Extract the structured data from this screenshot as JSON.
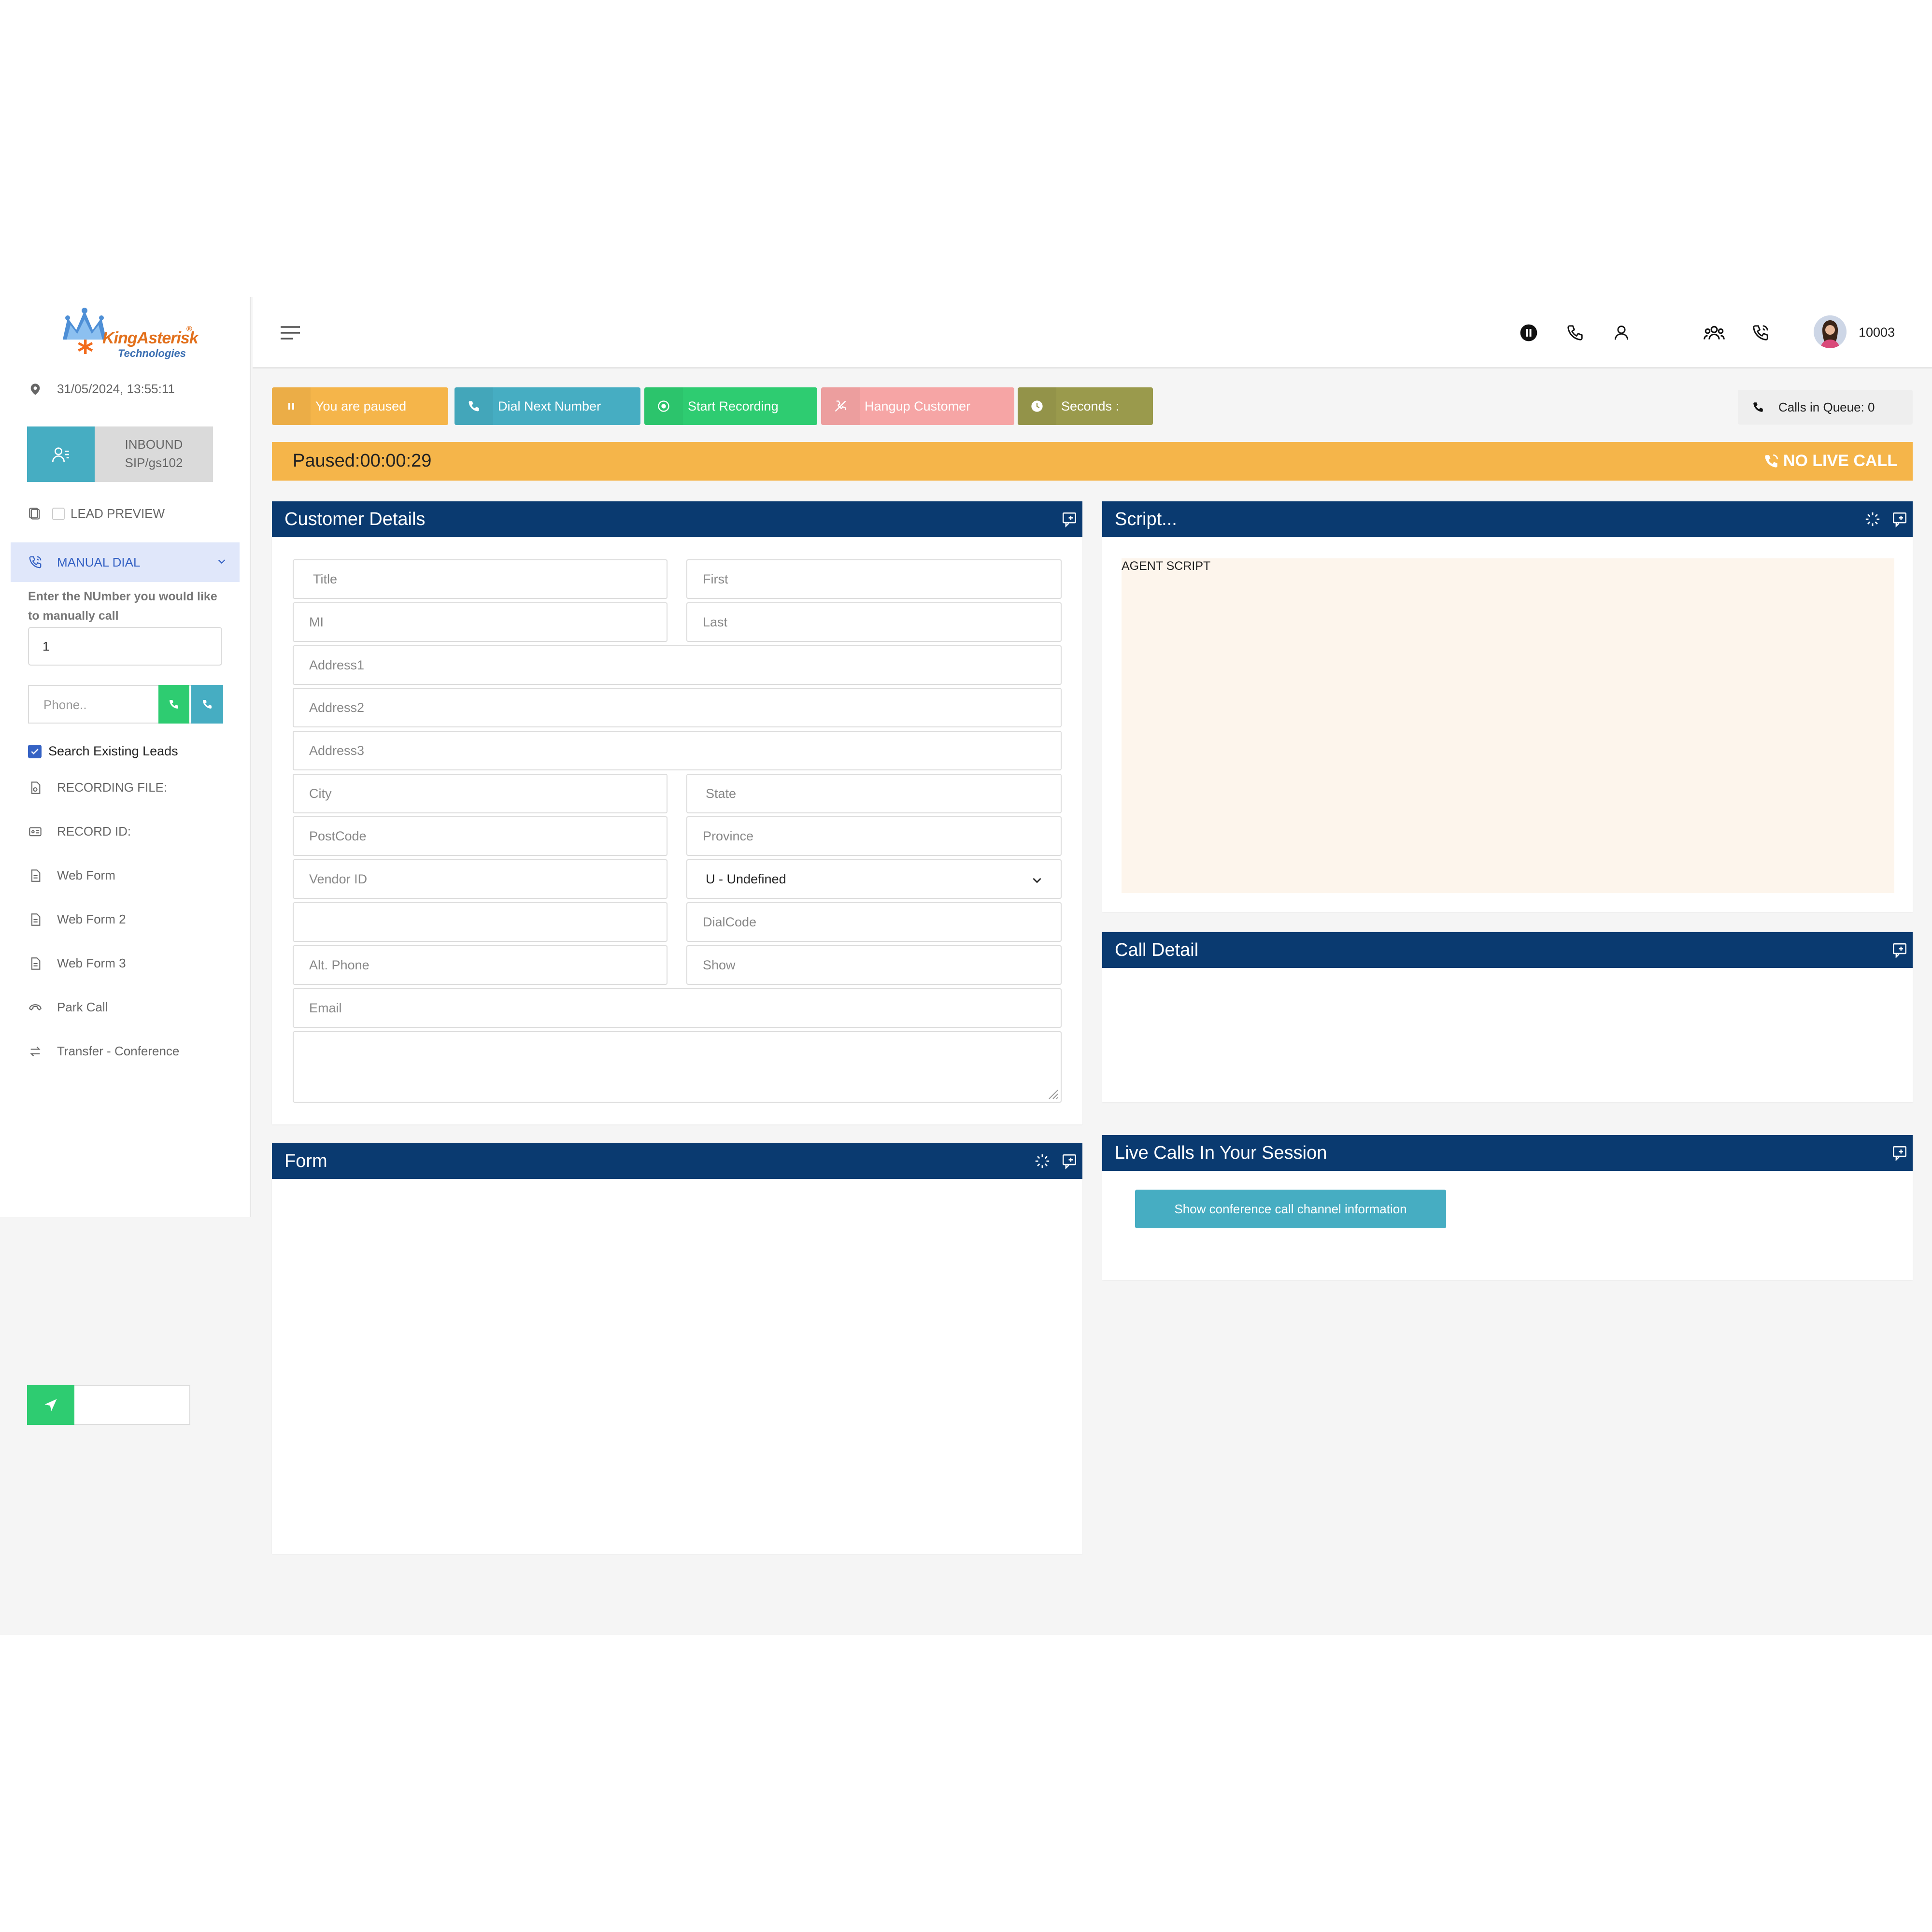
{
  "brand": {
    "name": "KingAsterisk",
    "tagline": "Technologies",
    "trademark": "®"
  },
  "sidebar": {
    "datetime": "31/05/2024, 13:55:11",
    "inbound": {
      "line1": "INBOUND",
      "line2": "SIP/gs102"
    },
    "lead_preview": "LEAD PREVIEW",
    "manual_dial": "MANUAL DIAL",
    "manual_label": "Enter the NUmber you would like to manually call",
    "manual_value": "1",
    "phone_placeholder": "Phone..",
    "search_existing": "Search Existing Leads",
    "items": [
      {
        "label": "RECORDING FILE:",
        "icon": "recording-file-icon"
      },
      {
        "label": "RECORD ID:",
        "icon": "id-card-icon"
      },
      {
        "label": "Web Form",
        "icon": "document-icon"
      },
      {
        "label": "Web Form 2",
        "icon": "document-icon"
      },
      {
        "label": "Web Form 3",
        "icon": "document-icon"
      },
      {
        "label": "Park Call",
        "icon": "park-call-icon"
      },
      {
        "label": "Transfer - Conference",
        "icon": "transfer-icon"
      }
    ]
  },
  "header": {
    "user_id": "10003"
  },
  "actions": {
    "paused": "You are paused",
    "dial_next": "Dial Next Number",
    "start_recording": "Start Recording",
    "hangup": "Hangup Customer",
    "seconds": "Seconds :",
    "calls_in_queue": "Calls in Queue: 0"
  },
  "status": {
    "paused_time": "Paused:00:00:29",
    "no_live_call": "NO LIVE CALL"
  },
  "customer_details": {
    "title": "Customer Details",
    "placeholders": {
      "title": "Title",
      "first": "First",
      "mi": "MI",
      "last": "Last",
      "address1": "Address1",
      "address2": "Address2",
      "address3": "Address3",
      "city": "City",
      "state": "State",
      "postcode": "PostCode",
      "province": "Province",
      "vendor_id": "Vendor ID",
      "dialcode": "DialCode",
      "alt_phone": "Alt. Phone",
      "show": "Show",
      "email": "Email"
    },
    "gender_selected": "U - Undefined"
  },
  "script_panel": {
    "title": "Script...",
    "content": "AGENT SCRIPT"
  },
  "call_detail": {
    "title": "Call Detail"
  },
  "live_calls": {
    "title": "Live Calls In Your Session",
    "button": "Show conference call channel information"
  },
  "form_panel": {
    "title": "Form"
  },
  "colors": {
    "navy": "#0a3a70",
    "paused": "#f5b54a",
    "teal": "#46adc2",
    "green": "#2ecc71",
    "pink": "#f6a5a5",
    "olive": "#9a9a4c",
    "script_bg": "#fdf5ec"
  }
}
